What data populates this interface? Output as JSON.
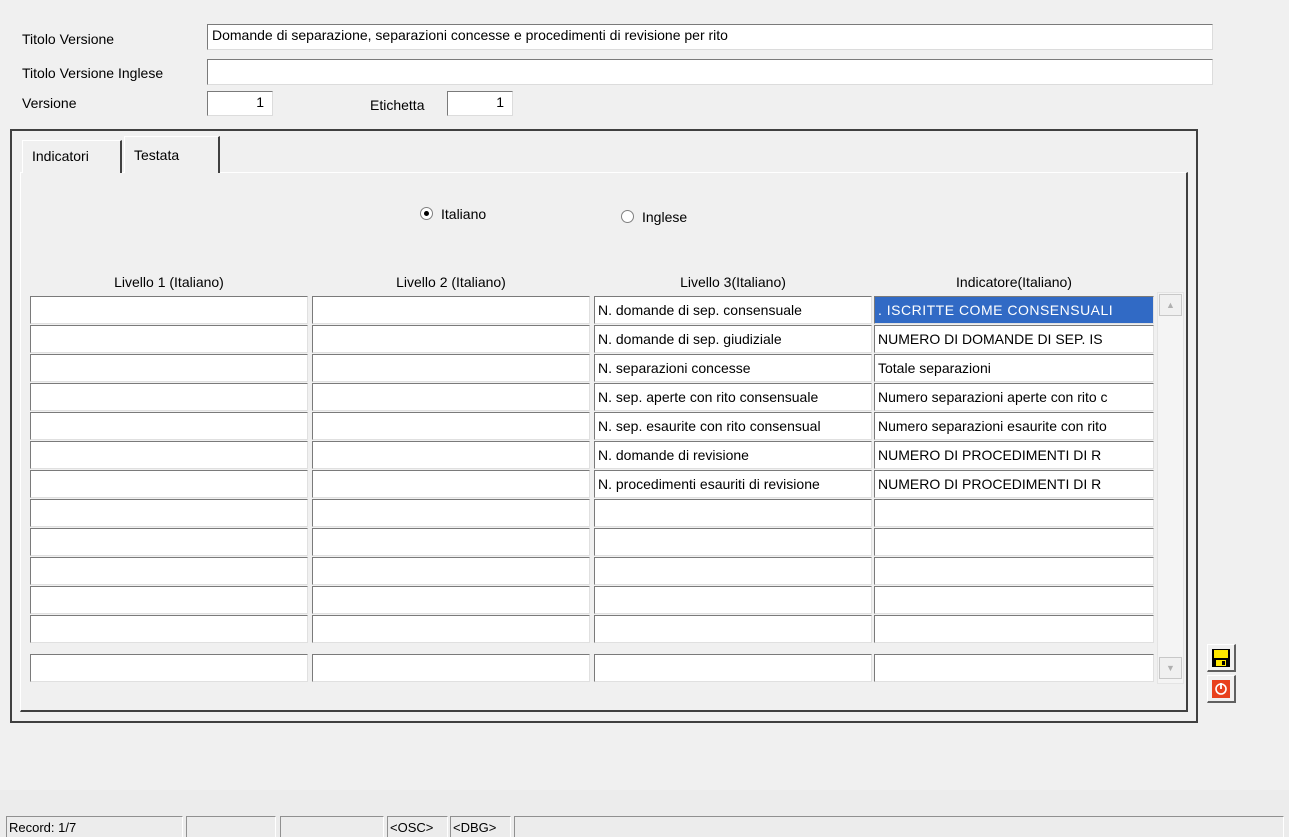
{
  "header": {
    "titolo_versione_label": "Titolo Versione",
    "titolo_versione_value": "Domande di separazione, separazioni concesse e procedimenti di revisione per rito",
    "titolo_inglese_label": "Titolo Versione Inglese",
    "titolo_inglese_value": "",
    "versione_label": "Versione",
    "versione_value": "1",
    "etichetta_label": "Etichetta",
    "etichetta_value": "1"
  },
  "tabs": [
    {
      "label": "Indicatori"
    },
    {
      "label": "Testata"
    }
  ],
  "language": {
    "italiano_label": "Italiano",
    "inglese_label": "Inglese",
    "selected": "Italiano"
  },
  "grid": {
    "columns": [
      "Livello 1 (Italiano)",
      "Livello 2 (Italiano)",
      "Livello 3(Italiano)",
      "Indicatore(Italiano)"
    ],
    "rows": [
      {
        "c1": "",
        "c2": "",
        "c3": "N. domande di sep. consensuale",
        "c4": ". ISCRITTE COME CONSENSUALI"
      },
      {
        "c1": "",
        "c2": "",
        "c3": "N. domande di sep. giudiziale",
        "c4": "NUMERO DI DOMANDE DI SEP. IS"
      },
      {
        "c1": "",
        "c2": "",
        "c3": "N. separazioni concesse",
        "c4": "Totale separazioni"
      },
      {
        "c1": "",
        "c2": "",
        "c3": "N. sep. aperte con rito consensuale",
        "c4": "Numero separazioni aperte con rito c"
      },
      {
        "c1": "",
        "c2": "",
        "c3": "N. sep. esaurite con rito consensual",
        "c4": "Numero separazioni esaurite con rito"
      },
      {
        "c1": "",
        "c2": "",
        "c3": "N. domande di revisione",
        "c4": "NUMERO DI PROCEDIMENTI DI R"
      },
      {
        "c1": "",
        "c2": "",
        "c3": "N. procedimenti esauriti di revisione",
        "c4": "NUMERO DI PROCEDIMENTI DI R"
      },
      {
        "c1": "",
        "c2": "",
        "c3": "",
        "c4": ""
      },
      {
        "c1": "",
        "c2": "",
        "c3": "",
        "c4": ""
      },
      {
        "c1": "",
        "c2": "",
        "c3": "",
        "c4": ""
      },
      {
        "c1": "",
        "c2": "",
        "c3": "",
        "c4": ""
      },
      {
        "c1": "",
        "c2": "",
        "c3": "",
        "c4": ""
      },
      {
        "c1": "",
        "c2": "",
        "c3": "",
        "c4": ""
      }
    ]
  },
  "buttons": {
    "save_icon": "floppy-disk-icon",
    "exit_icon": "power-icon"
  },
  "status": {
    "record": "Record: 1/7",
    "osc": "<OSC>",
    "dbg": "<DBG>"
  }
}
